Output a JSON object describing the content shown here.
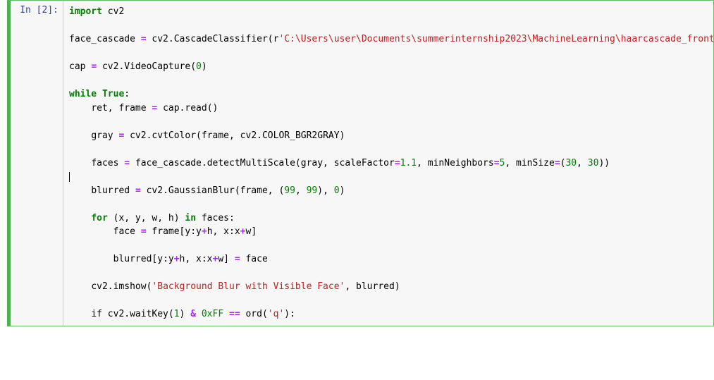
{
  "cell": {
    "prompt_prefix": "In [",
    "prompt_num": "2",
    "prompt_suffix": "]:",
    "code": {
      "l1": {
        "kw": "import",
        "mod": "cv2"
      },
      "l3": {
        "lhs": "face_cascade",
        "eq": "=",
        "mod": "cv2",
        "dot": ".",
        "fn": "CascadeClassifier",
        "open": "(",
        "rpfx": "r",
        "str": "'C:\\Users\\user\\Documents\\summerinternship2023\\MachineLearning\\haarcascade_frontalface_defau"
      },
      "l5": {
        "lhs": "cap",
        "eq": "=",
        "mod": "cv2",
        "dot": ".",
        "fn": "VideoCapture",
        "open": "(",
        "arg": "0",
        "close": ")"
      },
      "l7": {
        "kw": "while",
        "val": "True",
        "colon": ":"
      },
      "l8": {
        "lhs": "ret, frame",
        "eq": "=",
        "obj": "cap",
        "dot": ".",
        "fn": "read",
        "parens": "()"
      },
      "l10": {
        "lhs": "gray",
        "eq": "=",
        "mod": "cv2",
        "dot": ".",
        "fn": "cvtColor",
        "open": "(",
        "arg1": "frame, cv2",
        "dot2": ".",
        "const": "COLOR_BGR2GRAY",
        "close": ")"
      },
      "l12": {
        "lhs": "faces",
        "eq": "=",
        "obj": "face_cascade",
        "dot": ".",
        "fn": "detectMultiScale",
        "open": "(",
        "arg1": "gray, scaleFactor",
        "eq2": "=",
        "v1": "1.1",
        "c1": ", minNeighbors",
        "eq3": "=",
        "v2": "5",
        "c2": ", minSize",
        "eq4": "=",
        "open2": "(",
        "v3": "30",
        "comma": ", ",
        "v4": "30",
        "close2": "))"
      },
      "l14": {
        "lhs": "blurred",
        "eq": "=",
        "mod": "cv2",
        "dot": ".",
        "fn": "GaussianBlur",
        "open": "(",
        "arg1": "frame, (",
        "v1": "99",
        "c1": ", ",
        "v2": "99",
        "c2": "), ",
        "v3": "0",
        "close": ")"
      },
      "l16": {
        "kw": "for",
        "vars": "(x, y, w, h)",
        "kw2": "in",
        "iter": "faces",
        "colon": ":"
      },
      "l17": {
        "lhs": "face",
        "eq": "=",
        "rhs1": "frame[y:y",
        "op1": "+",
        "rhs2": "h, x:x",
        "op2": "+",
        "rhs3": "w]"
      },
      "l19": {
        "lhs1": "blurred[y:y",
        "op1": "+",
        "lhs2": "h, x:x",
        "op2": "+",
        "lhs3": "w]",
        "eq": "=",
        "rhs": "face"
      },
      "l21": {
        "mod": "cv2",
        "dot": ".",
        "fn": "imshow",
        "open": "(",
        "str": "'Background Blur with Visible Face'",
        "c": ", blurred",
        "close": ")"
      },
      "l23": {
        "pre": "if cv2.waitKey(",
        "v1": "1",
        "mid": ") ",
        "amp": "&",
        "sp": " ",
        "hex": "0xFF",
        "sp2": " ",
        "eqeq": "==",
        "sp3": " ord(",
        "str": "'q'",
        "tail": "):"
      }
    }
  }
}
